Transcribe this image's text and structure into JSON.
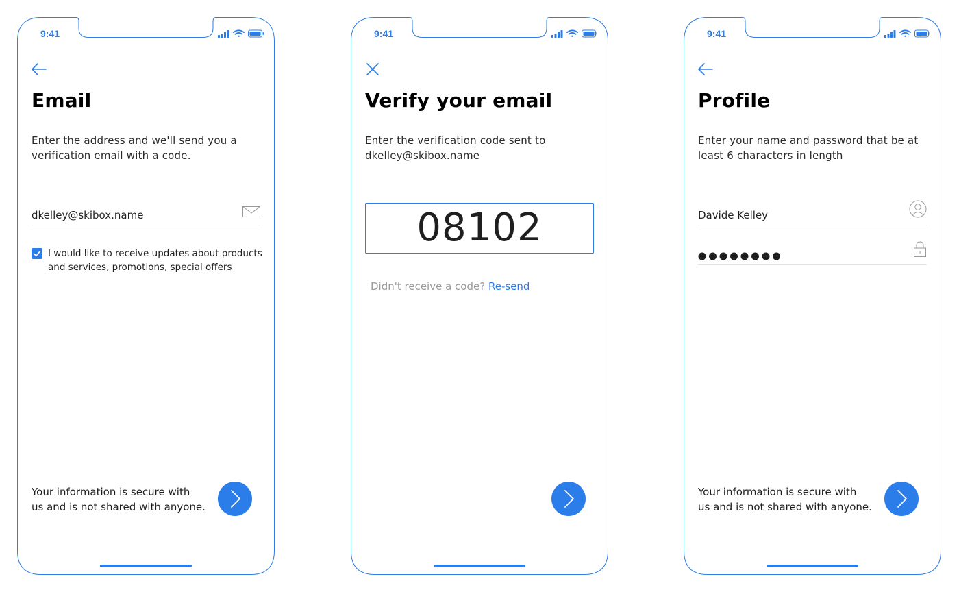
{
  "theme": {
    "accent": "#2b7de9",
    "title_color": "#000000",
    "muted": "#9a9a9a"
  },
  "status_bar": {
    "time": "9:41",
    "icons": [
      "signal-icon",
      "wifi-icon",
      "battery-icon"
    ]
  },
  "screens": [
    {
      "id": "email",
      "nav_icon": "back-arrow-icon",
      "title": "Email",
      "description_lines": [
        "Enter the address and we'll send you a",
        "verification email with a code."
      ],
      "email_field": {
        "value": "dkelley@skibox.name",
        "icon": "mail-icon"
      },
      "consent": {
        "checked": true,
        "label_lines": [
          "I would like to receive updates about products",
          "and services, promotions, special offers"
        ]
      },
      "footer_lines": [
        "Your information is secure with",
        "us and is not shared with anyone."
      ],
      "next_icon": "chevron-right-icon"
    },
    {
      "id": "verify",
      "nav_icon": "close-icon",
      "title": "Verify your email",
      "description_lines": [
        "Enter the verification code sent to",
        "dkelley@skibox.name"
      ],
      "code": "08102",
      "resend": {
        "prompt": "Didn't receive a code?",
        "link": "Re-send"
      },
      "next_icon": "chevron-right-icon"
    },
    {
      "id": "profile",
      "nav_icon": "back-arrow-icon",
      "title": "Profile",
      "description_lines": [
        "Enter your name and password that be at",
        "least 6 characters in length"
      ],
      "name_field": {
        "value": "Davide Kelley",
        "icon": "user-icon"
      },
      "password_field": {
        "masked_length": 8,
        "icon": "lock-icon"
      },
      "footer_lines": [
        "Your information is secure with",
        "us and is not shared with anyone."
      ],
      "next_icon": "chevron-right-icon"
    }
  ]
}
